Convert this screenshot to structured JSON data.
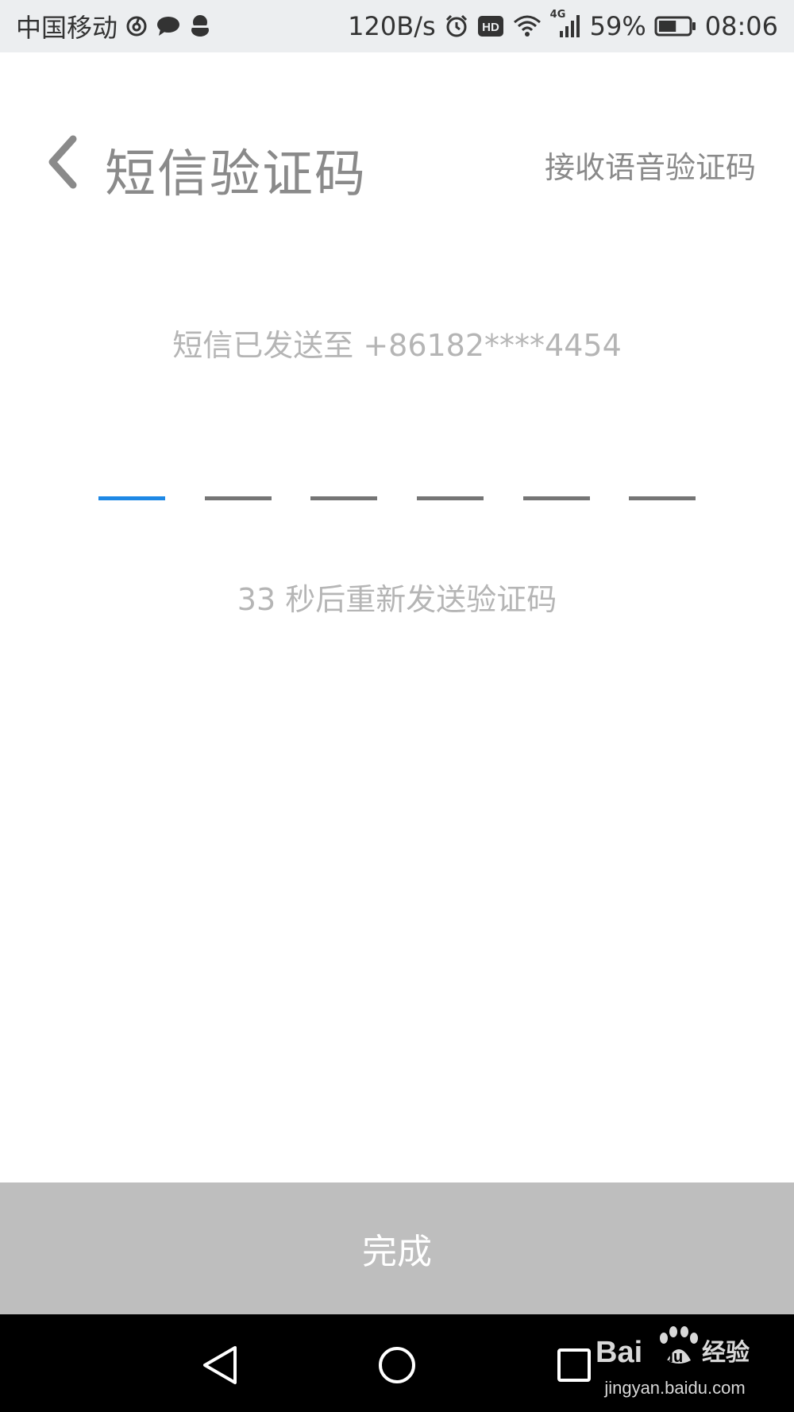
{
  "status_bar": {
    "carrier": "中国移动",
    "network_speed": "120B/s",
    "hd_badge": "HD",
    "network_type": "4G",
    "battery_percent": "59%",
    "battery_level": 0.59,
    "time": "08:06",
    "left_icons": [
      "netease-music-icon",
      "chat-bubble-icon",
      "qq-penguin-icon"
    ],
    "right_icons": [
      "alarm-icon",
      "hd-icon",
      "wifi-icon",
      "signal-icon",
      "battery-icon"
    ]
  },
  "header": {
    "title": "短信验证码",
    "voice_link": "接收语音验证码"
  },
  "verification": {
    "sent_info": "短信已发送至 +86182****4454",
    "code_length": 6,
    "active_slot": 0,
    "resend_text": "33 秒后重新发送验证码"
  },
  "done_button": {
    "label": "完成"
  },
  "watermark": {
    "logo_text": "Bai du 经验",
    "url": "jingyan.baidu.com"
  },
  "colors": {
    "accent": "#1e88e5",
    "slot_line": "#757575",
    "button_disabled": "#bebebe",
    "status_bar_bg": "#eceef0"
  }
}
